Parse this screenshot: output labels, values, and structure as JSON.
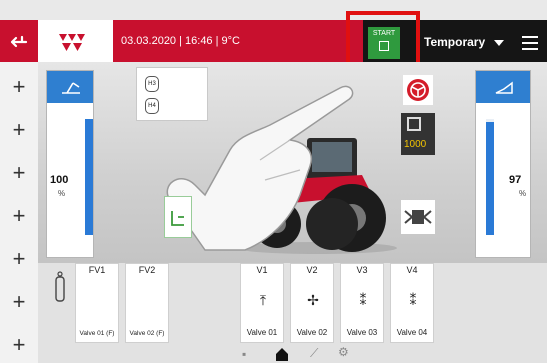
{
  "header": {
    "datetime": "03.03.2020 | 16:46 | 9°C",
    "start_label": "START",
    "profile_label": "Temporary"
  },
  "left_panel": {
    "percent": "100",
    "unit": "%",
    "level": 1.0
  },
  "right_panel": {
    "percent": "97",
    "unit": "%",
    "level": 0.97
  },
  "hitch_buttons": [
    "H3",
    "H4"
  ],
  "pto": {
    "value": "1000"
  },
  "valves_front": [
    {
      "header": "FV1",
      "name": "Valve 01 (F)"
    },
    {
      "header": "FV2",
      "name": "Valve 02 (F)"
    }
  ],
  "valves_rear": [
    {
      "header": "V1",
      "name": "Valve 01"
    },
    {
      "header": "V2",
      "name": "Valve 02"
    },
    {
      "header": "V3",
      "name": "Valve 03"
    },
    {
      "header": "V4",
      "name": "Valve 04"
    }
  ],
  "plus_count": 7,
  "colors": {
    "brand_red": "#c8102e",
    "accent_blue": "#2a7ad6",
    "start_green": "#2f9a3e",
    "highlight_red": "#e01010",
    "pto_yellow": "#f3c400"
  },
  "icons": [
    "back-arrow-icon",
    "massey-ferguson-logo",
    "menu-icon",
    "plus-icon",
    "steering-icon",
    "pto-icon",
    "differential-lock-icon",
    "home-icon",
    "camera-icon",
    "hitch-icon",
    "settings-icon"
  ]
}
